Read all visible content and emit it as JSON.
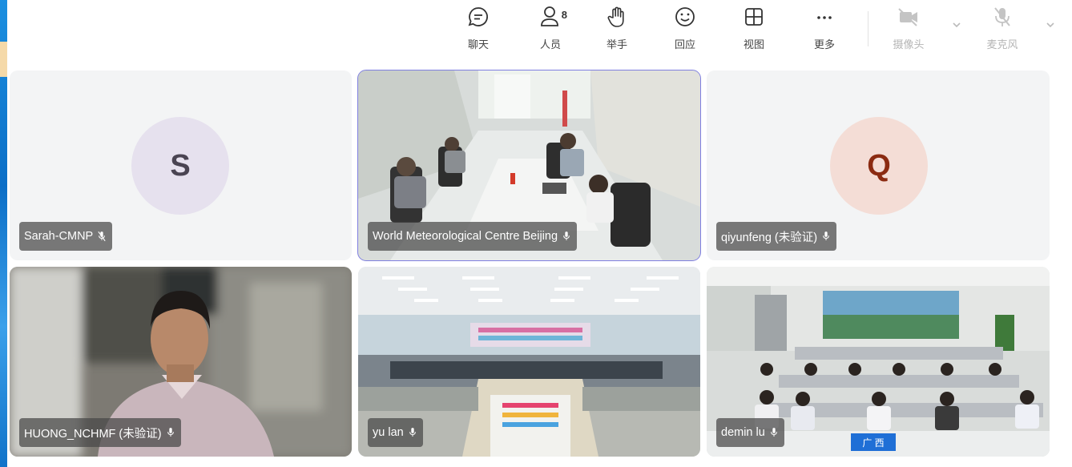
{
  "toolbar": {
    "chat_label": "聊天",
    "participants_label": "人员",
    "participants_count": "8",
    "raise_hand_label": "举手",
    "reaction_label": "回应",
    "view_label": "视图",
    "more_label": "更多",
    "camera_label": "摄像头",
    "microphone_label": "麦克风"
  },
  "participants": [
    {
      "name": "Sarah-CMNP",
      "initial": "S",
      "avatar_color": "#e6e1ee",
      "initial_color": "#4a4452",
      "mic": "muted"
    },
    {
      "name": "World Meteorological Centre Beijing",
      "mic": "on",
      "active_speaker": true
    },
    {
      "name": "qiyunfeng (未验证)",
      "initial": "Q",
      "avatar_color": "#f4ddd6",
      "initial_color": "#8b2b12",
      "mic": "on"
    },
    {
      "name": "HUONG_NCHMF (未验证)",
      "mic": "on"
    },
    {
      "name": "yu lan",
      "mic": "on"
    },
    {
      "name": "demin lu",
      "mic": "on",
      "sign_text": "广 西"
    }
  ],
  "colors": {
    "active_border": "#7f7fe0",
    "nameplate_bg": "#464646"
  }
}
